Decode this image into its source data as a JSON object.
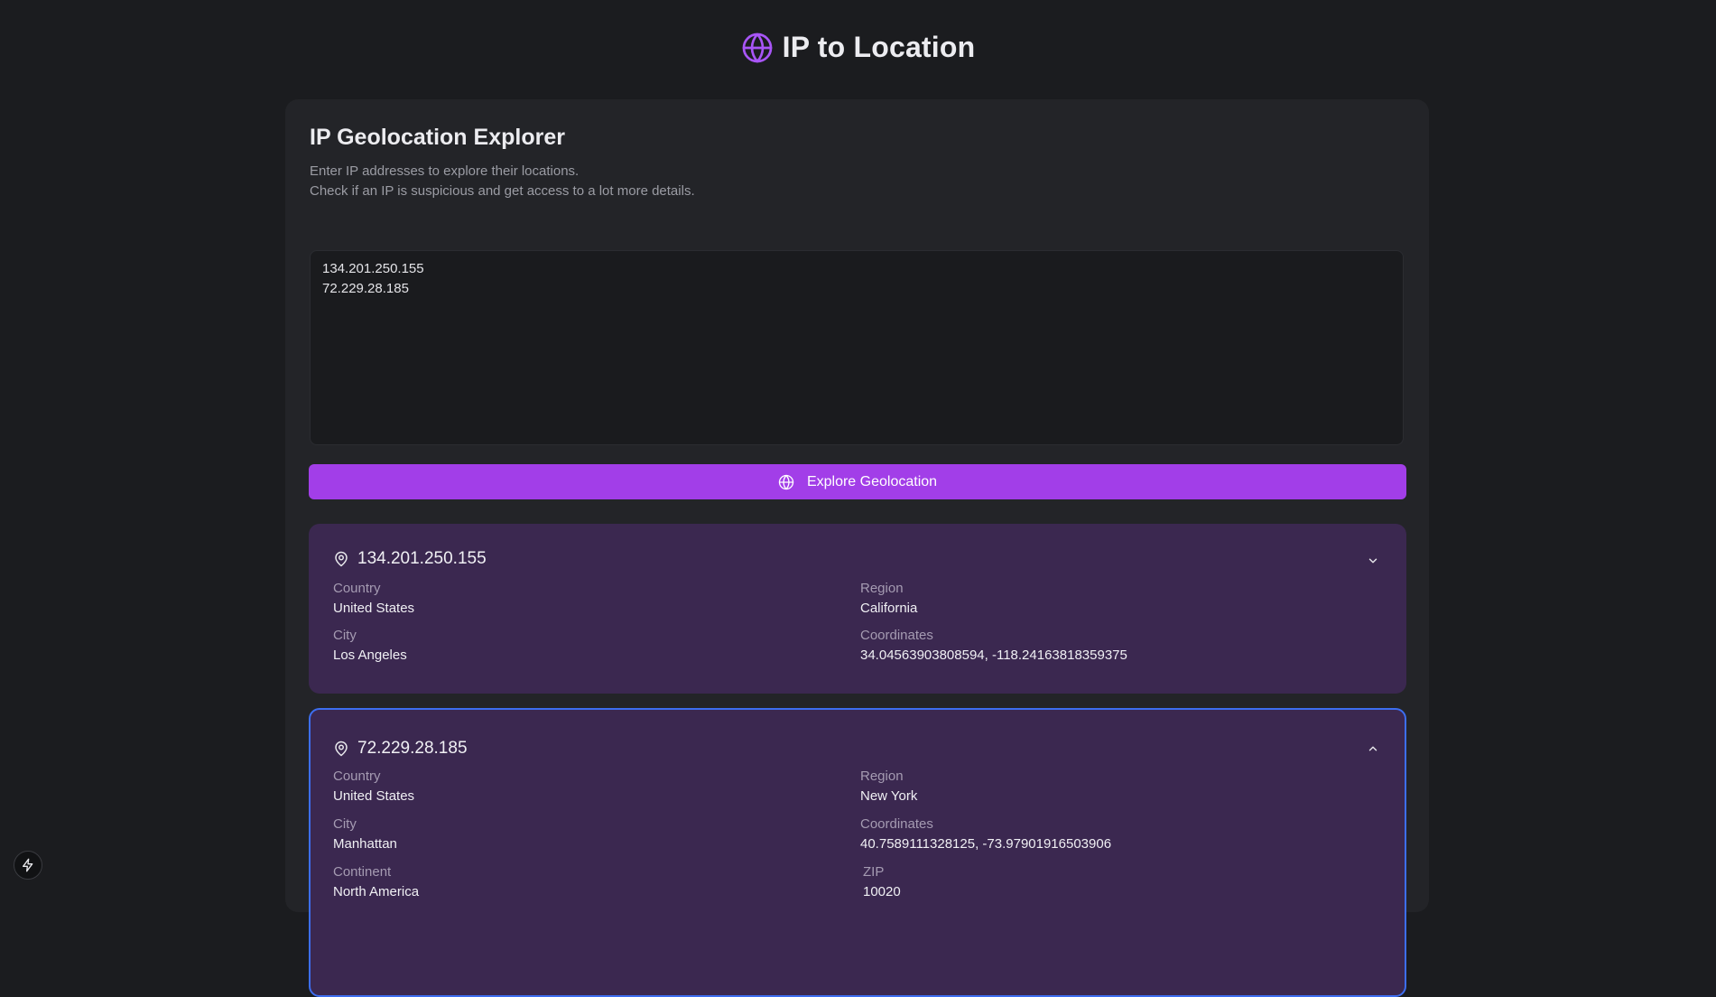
{
  "header": {
    "title": "IP to Location",
    "icon": "globe-icon",
    "accent": "#a855f7"
  },
  "panel": {
    "title": "IP Geolocation Explorer",
    "description_line1": "Enter IP addresses to explore their locations.",
    "description_line2": "Check if an IP is suspicious and get access to a lot more details.",
    "input_value": "134.201.250.155\n72.229.28.185",
    "button_label": "Explore Geolocation",
    "button_color": "#a23ee8"
  },
  "results": [
    {
      "ip": "134.201.250.155",
      "expanded": false,
      "fields": {
        "country_label": "Country",
        "country": "United States",
        "region_label": "Region",
        "region": "California",
        "city_label": "City",
        "city": "Los Angeles",
        "coordinates_label": "Coordinates",
        "coordinates": "34.04563903808594, -118.24163818359375"
      }
    },
    {
      "ip": "72.229.28.185",
      "expanded": true,
      "fields": {
        "country_label": "Country",
        "country": "United States",
        "region_label": "Region",
        "region": "New York",
        "city_label": "City",
        "city": "Manhattan",
        "coordinates_label": "Coordinates",
        "coordinates": "40.7589111328125, -73.97901916503906",
        "continent_label": "Continent",
        "continent": "North America",
        "zip_label": "ZIP",
        "zip": "10020"
      }
    }
  ],
  "floating_button": {
    "icon": "lightning-bolt-icon"
  }
}
